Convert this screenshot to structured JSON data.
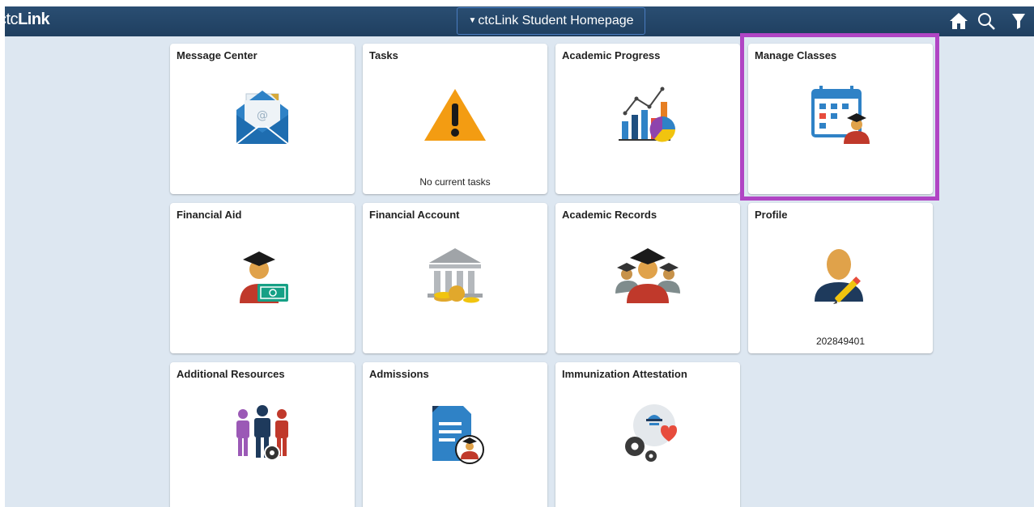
{
  "header": {
    "logo_prefix": "ctc",
    "logo_main": "Link",
    "homepage_label": "ctcLink Student Homepage",
    "caret": "▼"
  },
  "nav_icons": [
    "home-icon",
    "search-icon",
    "notifications-icon"
  ],
  "colors": {
    "header_bg": "#1f3f60",
    "page_bg": "#dde7f1",
    "highlight": "#b045c4"
  },
  "tiles": [
    {
      "title": "Message Center",
      "icon": "envelope-icon",
      "footer": ""
    },
    {
      "title": "Tasks",
      "icon": "warning-icon",
      "footer": "No current tasks"
    },
    {
      "title": "Academic Progress",
      "icon": "progress-chart-icon",
      "footer": ""
    },
    {
      "title": "Manage Classes",
      "icon": "calendar-student-icon",
      "footer": ""
    },
    {
      "title": "Financial Aid",
      "icon": "graduate-money-icon",
      "footer": ""
    },
    {
      "title": "Financial Account",
      "icon": "bank-coins-icon",
      "footer": ""
    },
    {
      "title": "Academic Records",
      "icon": "graduates-icon",
      "footer": ""
    },
    {
      "title": "Profile",
      "icon": "profile-edit-icon",
      "footer": "202849401"
    },
    {
      "title": "Additional Resources",
      "icon": "people-gear-icon",
      "footer": ""
    },
    {
      "title": "Admissions",
      "icon": "document-student-icon",
      "footer": ""
    },
    {
      "title": "Immunization Attestation",
      "icon": "health-gears-icon",
      "footer": ""
    }
  ]
}
